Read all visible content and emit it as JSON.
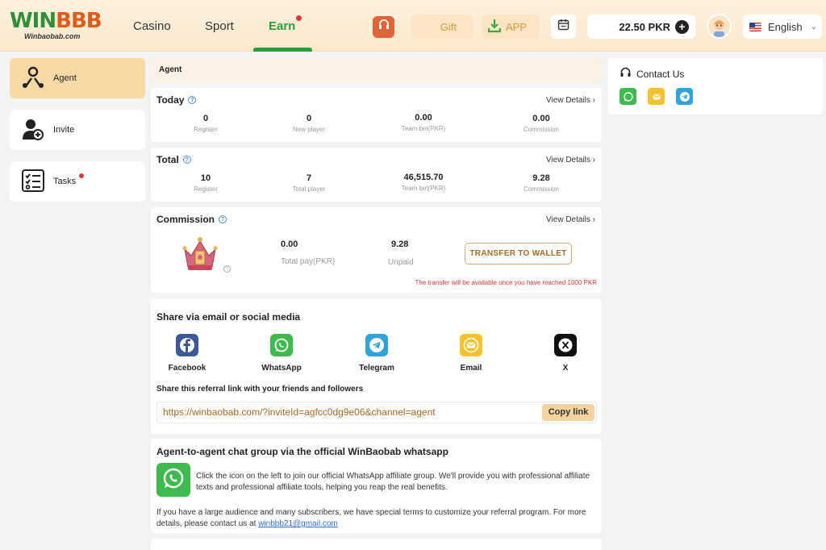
{
  "header": {
    "logo_text_a": "WIN",
    "logo_text_b": "BBB",
    "logo_sub": "Winbaobab.com",
    "nav": {
      "casino": "Casino",
      "sport": "Sport",
      "earn": "Earn"
    },
    "gift_label": "Gift",
    "app_label": "APP",
    "balance": "22.50 PKR",
    "language": "English"
  },
  "sidebar": {
    "items": [
      {
        "label": "Agent",
        "icon": "agent-icon"
      },
      {
        "label": "Invite",
        "icon": "invite-icon"
      },
      {
        "label": "Tasks",
        "icon": "tasks-icon"
      }
    ]
  },
  "breadcrumb": "Agent",
  "today": {
    "title": "Today",
    "view_details": "View Details ›",
    "stats": [
      {
        "value": "0",
        "label": "Register"
      },
      {
        "value": "0",
        "label": "New player"
      },
      {
        "value": "0.00",
        "label": "Team bet(PKR)"
      },
      {
        "value": "0.00",
        "label": "Commission"
      }
    ]
  },
  "total": {
    "title": "Total",
    "view_details": "View Details ›",
    "stats": [
      {
        "value": "10",
        "label": "Register"
      },
      {
        "value": "7",
        "label": "Total player"
      },
      {
        "value": "46,515.70",
        "label": "Team bet(PKR)"
      },
      {
        "value": "9.28",
        "label": "Commission"
      }
    ]
  },
  "commission": {
    "title": "Commission",
    "view_details": "View Details ›",
    "total_pay_value": "0.00",
    "total_pay_label": "Total pay(PKR)",
    "unpaid_value": "9.28",
    "unpaid_label": "Unpaid",
    "transfer_button": "TRANSFER TO WALLET",
    "note": "The transfer will be available once you have reached 1000 PKR"
  },
  "share": {
    "title": "Share via email or social media",
    "socials": [
      {
        "label": "Facebook",
        "icon": "facebook-icon",
        "color": "#3b5998"
      },
      {
        "label": "WhatsApp",
        "icon": "whatsapp-icon",
        "color": "#3dbb4f"
      },
      {
        "label": "Telegram",
        "icon": "telegram-icon",
        "color": "#2ea3dc"
      },
      {
        "label": "Email",
        "icon": "email-icon",
        "color": "#f5c12e"
      },
      {
        "label": "X",
        "icon": "x-icon",
        "color": "#111111"
      }
    ],
    "subtitle": "Share this referral link with your friends and followers",
    "link": "https://winbaobab.com/?inviteId=agfcc0dg9e06&channel=agent",
    "copy_label": "Copy link"
  },
  "chat": {
    "title": "Agent-to-agent chat group via the official WinBaobab whatsapp",
    "text1": "Click the icon on the left to join our official WhatsApp affiliate group. We'll provide you with professional affiliate texts and professional affiliate tools, helping you reap the real benefits.",
    "text2": "If you have a large audience and many subscribers, we have special terms to customize your referral program. For more details, please contact us at",
    "email": "winbbb21@gmail.com"
  },
  "contact": {
    "title": "Contact Us"
  },
  "colors": {
    "accent_green": "#2e9a3a",
    "accent_gold": "#f8d9a5",
    "warning_red": "#dd3333"
  }
}
